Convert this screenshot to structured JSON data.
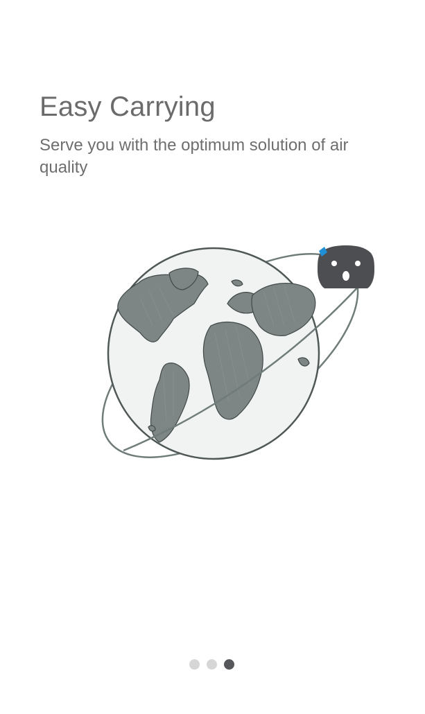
{
  "onboarding": {
    "title": "Easy Carrying",
    "subtitle": "Serve you with the optimum solution of air quality",
    "illustration": {
      "icons": [
        "globe-icon",
        "orbit-icon",
        "air-purifier-device-icon"
      ],
      "device_color": "#4d4e52",
      "device_accent": "#1f8fd6",
      "sketch_color": "#5e6a69"
    },
    "pager": {
      "total": 3,
      "current": 3,
      "active_color": "#56575b",
      "inactive_color": "#d6d6d6"
    }
  }
}
